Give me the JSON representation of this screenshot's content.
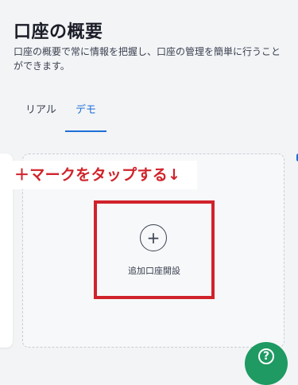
{
  "header": {
    "title": "口座の概要",
    "description": "口座の概要で常に情報を把握し、口座の管理を簡単に行うことができます。"
  },
  "tabs": [
    {
      "label": "リアル",
      "active": false
    },
    {
      "label": "デモ",
      "active": true
    }
  ],
  "add_account": {
    "plus_glyph": "+",
    "label": "追加口座開設"
  },
  "annotation": {
    "text": "＋マークをタップする↓",
    "color": "#d0232b"
  },
  "help_button": {
    "glyph": "?"
  },
  "colors": {
    "accent": "#1d6fd8",
    "help_button": "#1f9a62"
  }
}
